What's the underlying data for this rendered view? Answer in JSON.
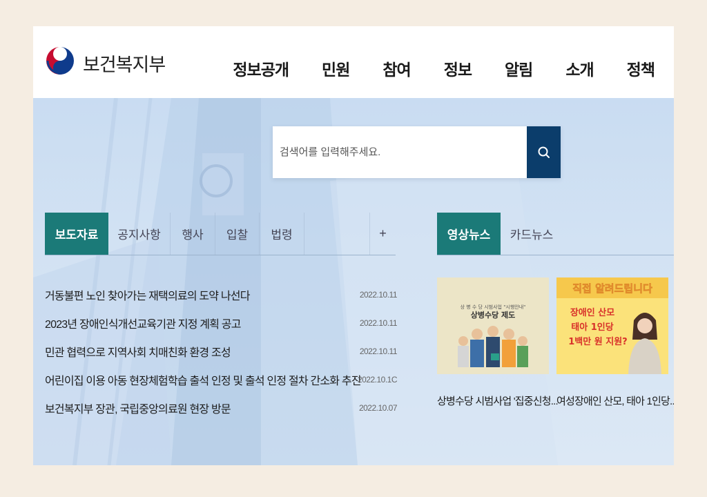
{
  "header": {
    "logo_text": "보건복지부",
    "nav": [
      "정보공개",
      "민원",
      "참여",
      "정보",
      "알림",
      "소개",
      "정책"
    ]
  },
  "search": {
    "placeholder": "검색어를 입력해주세요."
  },
  "news_tabs": {
    "items": [
      "보도자료",
      "공지사항",
      "행사",
      "입찰",
      "법령"
    ],
    "more": "+"
  },
  "news": [
    {
      "title": "거동불편 노인 찾아가는 재택의료의 도약 나선다",
      "date": "2022.10.11"
    },
    {
      "title": "2023년 장애인식개선교육기관 지정 계획 공고",
      "date": "2022.10.11"
    },
    {
      "title": "민관 협력으로 지역사회 치매친화 환경 조성",
      "date": "2022.10.11"
    },
    {
      "title": "어린이집 이용 아동 현장체험학습 출석 인정 및 출석 인정 절차 간소화 추진",
      "date": "2022.10.1C"
    },
    {
      "title": "보건복지부 장관, 국립중앙의료원 현장 방문",
      "date": "2022.10.07"
    }
  ],
  "video_tabs": [
    "영상뉴스",
    "카드뉴스"
  ],
  "videos": [
    {
      "caption": "상병수당 시범사업 '집중신청...",
      "thumb_small": "상 병 수 당 시범사업 \"시행안내\"",
      "thumb_title": "상병수당 제도"
    },
    {
      "caption": "여성장애인 산모, 태아 1인당...",
      "thumb_banner": "직접 알려드립니다",
      "thumb_lines": [
        "장애인 산모",
        "태아 1인당",
        "1백만 원 지원?"
      ]
    }
  ],
  "colors": {
    "accent": "#1b7a78",
    "search_button": "#0b3d6b"
  }
}
